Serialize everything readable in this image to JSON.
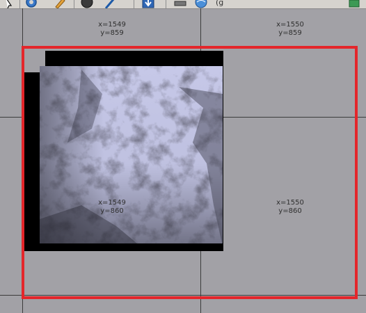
{
  "toolbar": {
    "partial_text": "(g",
    "icons": [
      "pointer-icon",
      "settings-gear-icon",
      "pencil-icon",
      "globe-dark-icon",
      "pen-tool-icon",
      "export-icon",
      "stack-icon",
      "globe-blue-icon",
      "layers-icon"
    ]
  },
  "tiles": {
    "top_left": {
      "x": "x=1549",
      "y": "y=859"
    },
    "top_right": {
      "x": "x=1550",
      "y": "y=859"
    },
    "bottom_left": {
      "x": "x=1549",
      "y": "y=860"
    },
    "bottom_right": {
      "x": "x=1550",
      "y": "y=860"
    }
  },
  "colors": {
    "background": "#a2a1a6",
    "selection": "#e4262b",
    "grid": "#3b3b3b",
    "image_frame": "#000000"
  }
}
